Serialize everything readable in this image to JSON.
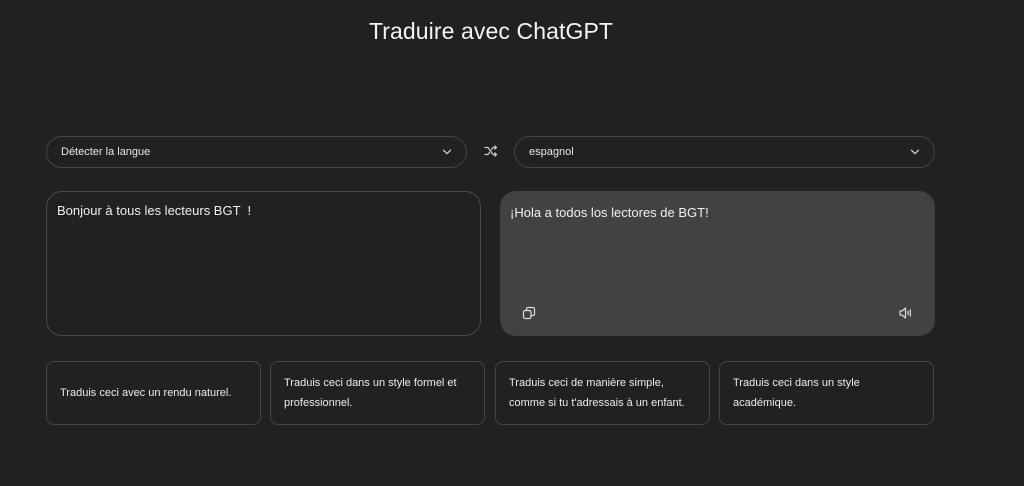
{
  "page": {
    "title": "Traduire avec ChatGPT"
  },
  "source": {
    "language": "Détecter la langue",
    "text": "Bonjour à tous les lecteurs BGT  !"
  },
  "target": {
    "language": "espagnol",
    "text": "¡Hola a todos los lectores de BGT!"
  },
  "suggestions": [
    "Traduis ceci avec un rendu naturel.",
    "Traduis ceci dans un style formel et professionnel.",
    "Traduis ceci de manière simple, comme si tu t'adressais à un enfant.",
    "Traduis ceci dans un style académique."
  ],
  "icons": {
    "swap": "swap-arrows-icon",
    "chevron": "chevron-down-icon",
    "copy": "copy-icon",
    "speaker": "speaker-icon"
  },
  "colors": {
    "background": "#212121",
    "output_panel": "#424242",
    "border": "#444444",
    "text": "#ececec"
  }
}
